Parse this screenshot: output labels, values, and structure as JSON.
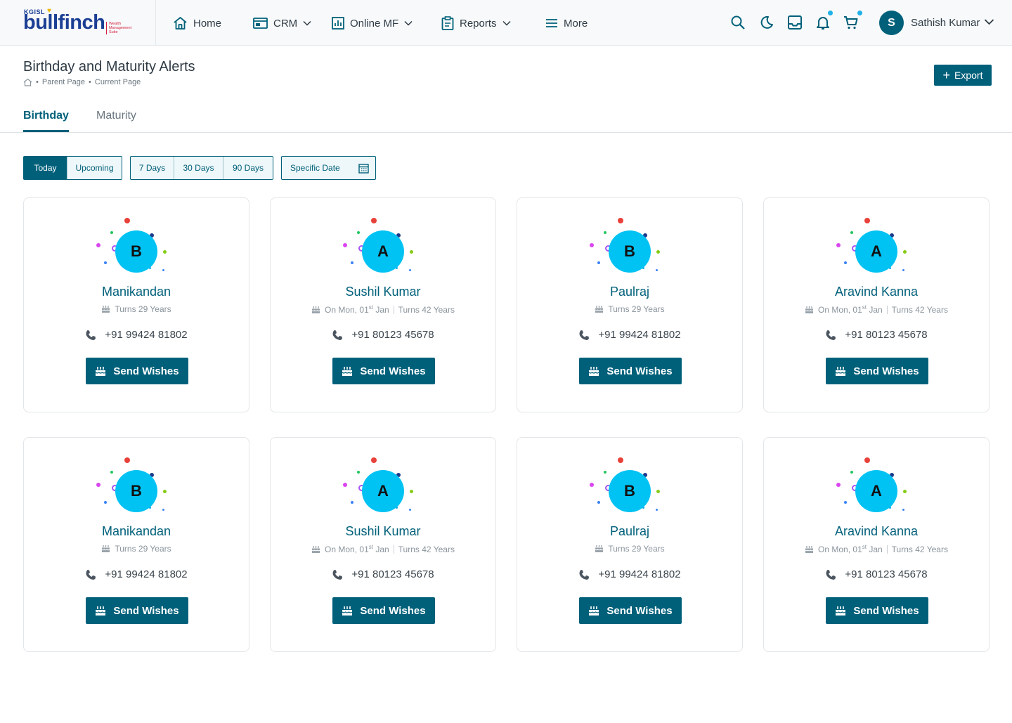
{
  "brand": {
    "kgisl": "KGISL",
    "wordmark": "bullfinch",
    "sub1": "Wealth",
    "sub2": "Management",
    "sub3": "Suite"
  },
  "nav": {
    "home": "Home",
    "crm": "CRM",
    "online_mf": "Online MF",
    "reports": "Reports",
    "more": "More"
  },
  "user": {
    "initial": "S",
    "name": "Sathish Kumar"
  },
  "page": {
    "title": "Birthday and Maturity Alerts",
    "export": "Export"
  },
  "breadcrumb": {
    "parent": "Parent Page",
    "current": "Current Page"
  },
  "tabs": {
    "birthday": "Birthday",
    "maturity": "Maturity"
  },
  "filters": {
    "today": "Today",
    "upcoming": "Upcoming",
    "d7": "7 Days",
    "d30": "30 Days",
    "d90": "90 Days",
    "specific": "Specific Date"
  },
  "labels": {
    "send_wishes": "Send Wishes"
  },
  "colors": {
    "primary": "#00607a",
    "avatar": "#00c2f3"
  },
  "cards": [
    {
      "initial": "B",
      "name": "Manikandan",
      "date": "",
      "turns": "Turns 29 Years",
      "phone": "+91 99424 81802"
    },
    {
      "initial": "A",
      "name": "Sushil Kumar",
      "date": "On Mon, 01st Jan",
      "turns": "Turns 42 Years",
      "phone": "+91 80123 45678"
    },
    {
      "initial": "B",
      "name": "Paulraj",
      "date": "",
      "turns": "Turns 29 Years",
      "phone": "+91 99424 81802"
    },
    {
      "initial": "A",
      "name": "Aravind Kanna",
      "date": "On Mon, 01st Jan",
      "turns": "Turns 42 Years",
      "phone": "+91 80123 45678"
    },
    {
      "initial": "B",
      "name": "Manikandan",
      "date": "",
      "turns": "Turns 29 Years",
      "phone": "+91 99424 81802"
    },
    {
      "initial": "A",
      "name": "Sushil Kumar",
      "date": "On Mon, 01st Jan",
      "turns": "Turns 42 Years",
      "phone": "+91 80123 45678"
    },
    {
      "initial": "B",
      "name": "Paulraj",
      "date": "",
      "turns": "Turns 29 Years",
      "phone": "+91 99424 81802"
    },
    {
      "initial": "A",
      "name": "Aravind Kanna",
      "date": "On Mon, 01st Jan",
      "turns": "Turns 42 Years",
      "phone": "+91 80123 45678"
    }
  ]
}
